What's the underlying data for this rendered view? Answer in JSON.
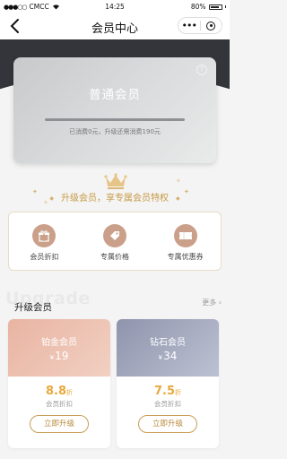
{
  "status_bar": {
    "carrier": "CMCC",
    "time": "14:25",
    "battery": "80%"
  },
  "nav": {
    "title": "会员中心"
  },
  "member_card": {
    "level": "普通会员",
    "progress_text": "已消费0元，升级还需消费190元",
    "progress_fraction": 0
  },
  "upgrade_banner": {
    "title": "升级会员，享专属会员特权"
  },
  "privileges": [
    {
      "label": "会员折扣",
      "icon": "gift-icon"
    },
    {
      "label": "专属价格",
      "icon": "price-tag-icon"
    },
    {
      "label": "专属优惠券",
      "icon": "coupon-icon"
    }
  ],
  "upgrade_section": {
    "watermark": "Upgrade",
    "title": "升级会员",
    "more": "更多"
  },
  "tiers": [
    {
      "name": "铂金会员",
      "currency": "¥",
      "price": "19",
      "discount": "8.8",
      "discount_unit": "折",
      "discount_label": "会员折扣",
      "button": "立即升级"
    },
    {
      "name": "钻石会员",
      "currency": "¥",
      "price": "34",
      "discount": "7.5",
      "discount_unit": "折",
      "discount_label": "会员折扣",
      "button": "立即升级"
    }
  ],
  "colors": {
    "accent_gold": "#c79a46",
    "header_dark": "#34353a",
    "platinum": "#e9b4a2",
    "diamond": "#8f94ad"
  }
}
